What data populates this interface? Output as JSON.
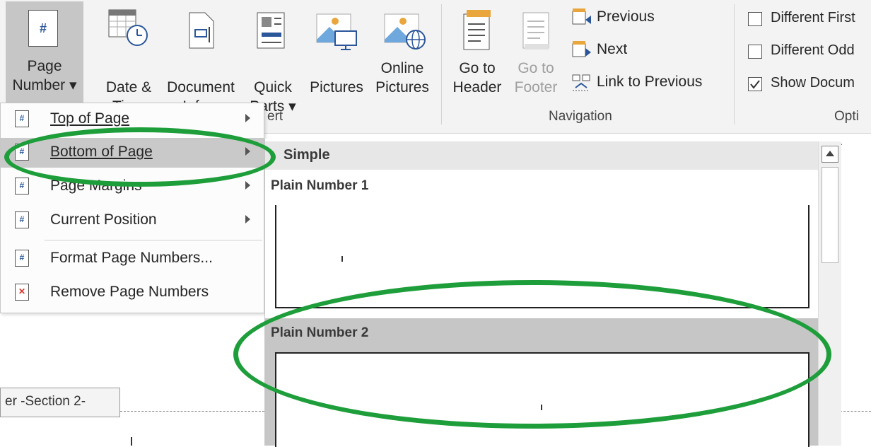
{
  "ribbon": {
    "page_number": {
      "line1": "Page",
      "line2": "Number ▾"
    },
    "date_time": {
      "line1": "Date &",
      "line2": "Time"
    },
    "document_info": {
      "line1": "Document",
      "line2": "Info ▾"
    },
    "quick_parts": {
      "line1": "Quick",
      "line2": "Parts ▾"
    },
    "pictures": {
      "line1": "Pictures",
      "line2": ""
    },
    "online_pictures": {
      "line1": "Online",
      "line2": "Pictures"
    },
    "go_to_header": {
      "line1": "Go to",
      "line2": "Header"
    },
    "go_to_footer": {
      "line1": "Go to",
      "line2": "Footer"
    },
    "previous": "Previous",
    "next": "Next",
    "link_to_previous": "Link to Previous",
    "group_insert": "ert",
    "group_navigation": "Navigation",
    "group_options": "Opti",
    "options": [
      {
        "label": "Different First",
        "checked": false
      },
      {
        "label": "Different Odd",
        "checked": false
      },
      {
        "label": "Show Docum",
        "checked": true
      }
    ]
  },
  "menu": {
    "items": [
      {
        "label": "Top of Page",
        "submenu": true
      },
      {
        "label": "Bottom of Page",
        "submenu": true
      },
      {
        "label": "Page Margins",
        "submenu": true
      },
      {
        "label": "Current Position",
        "submenu": true
      },
      {
        "label": "Format Page Numbers...",
        "submenu": false
      },
      {
        "label": "Remove Page Numbers",
        "submenu": false
      }
    ]
  },
  "gallery": {
    "section": "Simple",
    "items": [
      {
        "title": "Plain Number 1"
      },
      {
        "title": "Plain Number 2"
      }
    ]
  },
  "document": {
    "section_tag": "er -Section 2-"
  },
  "colors": {
    "annotation": "#1e9e3a",
    "selected": "#c9c9c9"
  }
}
